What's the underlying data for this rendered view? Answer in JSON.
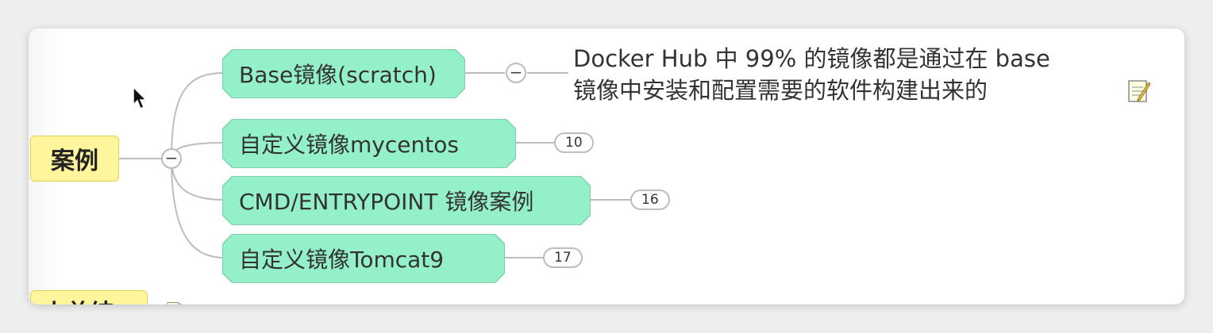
{
  "mindmap": {
    "root": {
      "label": "案例"
    },
    "root_toggle": "−",
    "branches": [
      {
        "label": "Base镜像(scratch)",
        "toggle": "−",
        "note": "Docker Hub 中 99% 的镜像都是通过在 base\n镜像中安装和配置需要的软件构建出来的",
        "note_icon": "note-icon"
      },
      {
        "label": "自定义镜像mycentos",
        "count": "10"
      },
      {
        "label": "CMD/ENTRYPOINT 镜像案例",
        "count": "16"
      },
      {
        "label": "自定义镜像Tomcat9",
        "count": "17"
      }
    ],
    "next_root": {
      "label": "小总结",
      "icon": "note-icon"
    }
  },
  "colors": {
    "root_fill": "#fff59d",
    "node_fill": "#94f0c8",
    "line": "#bbbbbb"
  }
}
